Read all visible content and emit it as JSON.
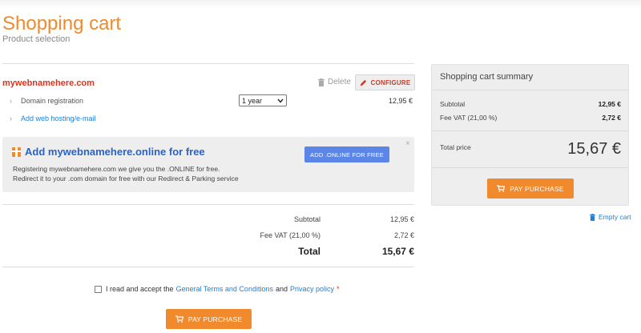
{
  "header": {
    "title": "Shopping cart",
    "subtitle": "Product selection"
  },
  "cart_item": {
    "domain": "mywebnamehere.com",
    "delete_label": "Delete",
    "configure_label": "CONFIGURE",
    "service": "Domain registration",
    "period_selected": "1 year",
    "service_price": "12,95 €",
    "add_hosting_label": "Add web hosting/e-mail"
  },
  "promo": {
    "title": "Add mywebnamehere.online for free",
    "line1": "Registering mywebnamehere.com we give you the .ONLINE for free.",
    "line2": "Redirect it to your .com domain for free with our Redirect & Parking service",
    "button": "ADD .ONLINE FOR FREE",
    "close": "×"
  },
  "totals": {
    "subtotal_label": "Subtotal",
    "subtotal_value": "12,95 €",
    "vat_label": "Fee VAT (21,00 %)",
    "vat_value": "2,72 €",
    "total_label": "Total",
    "total_value": "15,67 €"
  },
  "terms": {
    "prefix": "I read and accept the",
    "terms_link": "General Terms and Conditions",
    "and": "and",
    "privacy_link": "Privacy policy",
    "required_mark": "*"
  },
  "pay_button": "PAY PURCHASE",
  "summary": {
    "title": "Shopping cart summary",
    "subtotal_label": "Subtotal",
    "subtotal_value": "12,95 €",
    "vat_label": "Fee VAT (21,00 %)",
    "vat_value": "2,72 €",
    "total_label": "Total price",
    "total_value": "15,67 €",
    "pay_button": "PAY PURCHASE"
  },
  "empty_cart": "Empty cart",
  "colors": {
    "accent": "#f08a2c",
    "domain_red": "#d9341f",
    "link_blue": "#1e7fd8",
    "promo_blue": "#5b86e8"
  }
}
